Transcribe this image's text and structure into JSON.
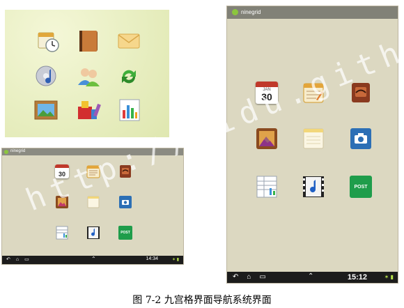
{
  "landscape": {
    "app_name": "ninegrid",
    "time": "14:34",
    "calendar_day": "30",
    "post_label": "POST"
  },
  "portrait": {
    "app_name": "ninegrid",
    "time": "15:12",
    "calendar_month": "JAN",
    "calendar_day": "30",
    "post_label": "POST"
  },
  "watermark": "http://yidu.github.io/",
  "caption": "图 7-2  九宫格界面导航系统界面"
}
